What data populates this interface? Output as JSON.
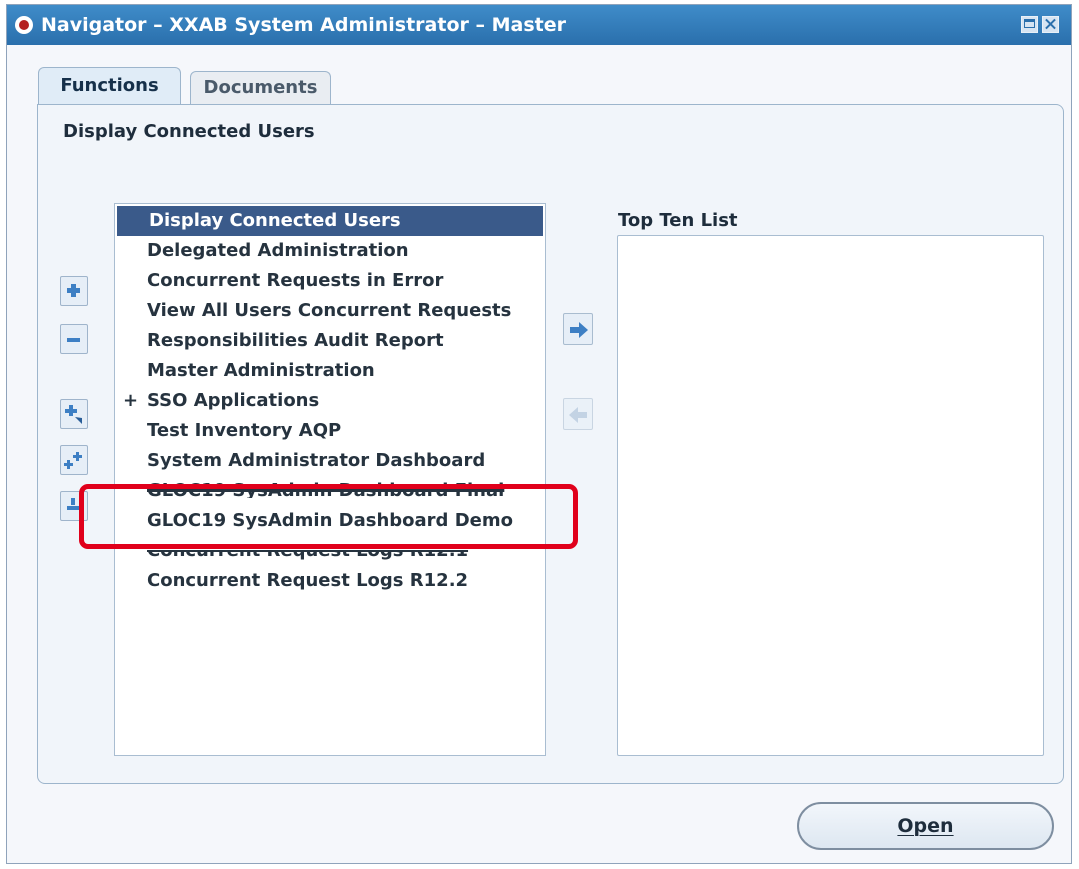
{
  "window": {
    "title": "Navigator – XXAB System Administrator – Master"
  },
  "tabs": [
    {
      "label": "Functions",
      "active": true
    },
    {
      "label": "Documents",
      "active": false
    }
  ],
  "panel": {
    "title": "Display Connected Users"
  },
  "function_list": {
    "items": [
      {
        "label": "Display Connected Users",
        "selected": true
      },
      {
        "label": "Delegated Administration"
      },
      {
        "label": "Concurrent Requests in Error"
      },
      {
        "label": "View All Users Concurrent Requests"
      },
      {
        "label": "Responsibilities Audit Report"
      },
      {
        "label": "Master Administration"
      },
      {
        "label": "SSO Applications",
        "expander": "+"
      },
      {
        "label": "Test Inventory AQP"
      },
      {
        "label": "System Administrator Dashboard"
      },
      {
        "label": "GLOC19 SysAdmin Dashboard Final"
      },
      {
        "label": "GLOC19 SysAdmin Dashboard Demo",
        "highlighted": true
      },
      {
        "label": "Concurrent Request Logs R12.1"
      },
      {
        "label": "Concurrent Request Logs R12.2"
      }
    ]
  },
  "top_ten": {
    "label": "Top Ten List"
  },
  "actions": {
    "open_label": "Open"
  },
  "icons": {
    "expand": "expand-plus-icon",
    "collapse": "collapse-minus-icon",
    "expand_branch": "expand-branch-icon",
    "expand_all": "expand-all-icon",
    "collapse_all": "collapse-all-icon",
    "add_to_top_ten": "arrow-right-icon",
    "remove_from_top_ten": "arrow-left-icon"
  },
  "colors": {
    "titlebar": "#2a6fac",
    "selection": "#3a5a8a",
    "highlight": "#e0001b"
  }
}
